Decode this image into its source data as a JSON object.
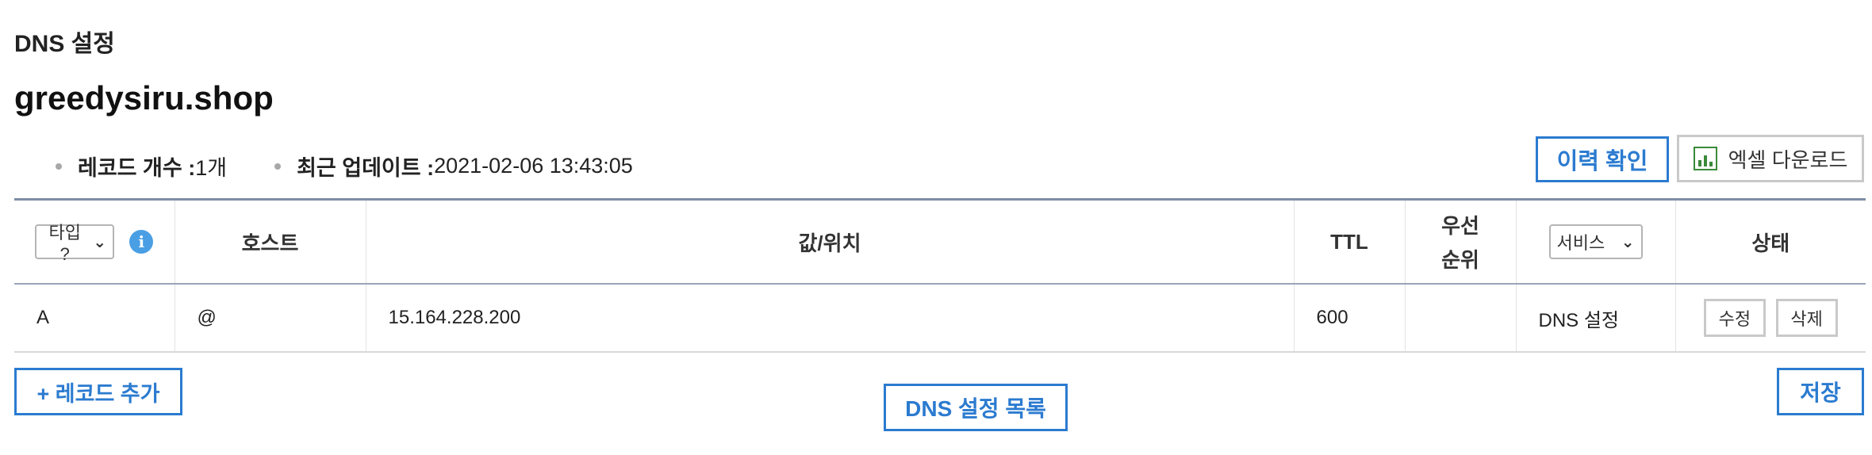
{
  "page_title": "DNS 설정",
  "domain": "greedysiru.shop",
  "summary": {
    "record_count_label": "레코드 개수 : ",
    "record_count_value": "1개",
    "last_update_label": "최근 업데이트 : ",
    "last_update_value": "2021-02-06 13:43:05"
  },
  "actions": {
    "history_label": "이력 확인",
    "excel_label": "엑셀 다운로드"
  },
  "table": {
    "type_filter_value": "타입 ?",
    "headers": {
      "host": "호스트",
      "value": "값/위치",
      "ttl": "TTL",
      "priority_line1": "우선",
      "priority_line2": "순위",
      "status": "상태"
    },
    "service_filter_value": "서비스",
    "rows": [
      {
        "type": "A",
        "host": "@",
        "value": "15.164.228.200",
        "ttl": "600",
        "priority": "",
        "service": "DNS 설정",
        "edit_label": "수정",
        "delete_label": "삭제"
      }
    ]
  },
  "footer": {
    "add_record_label": "+ 레코드 추가",
    "dns_list_label": "DNS 설정 목록",
    "save_label": "저장"
  },
  "colors": {
    "accent": "#2b7bd0",
    "info": "#4a9fe4",
    "excel_green": "#3a8a3a"
  },
  "icons": {
    "info": "info-icon",
    "excel": "excel-chart-icon",
    "dropdown": "chevron-down-icon"
  }
}
